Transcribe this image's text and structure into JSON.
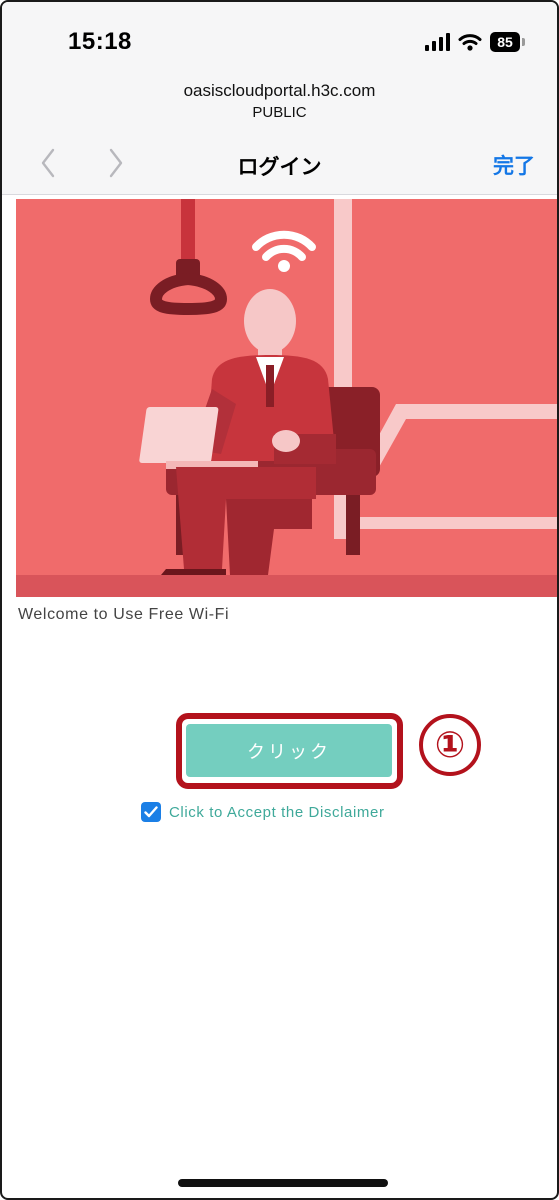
{
  "status_bar": {
    "time": "15:18",
    "battery": "85",
    "signal_icon": "signal-bars-icon",
    "wifi_icon": "wifi-icon"
  },
  "browser": {
    "domain": "oasiscloudportal.h3c.com",
    "ssid": "PUBLIC",
    "back_icon": "chevron-left-icon",
    "forward_icon": "chevron-right-icon",
    "title": "ログイン",
    "done_label": "完了"
  },
  "portal": {
    "welcome": "Welcome to Use Free Wi-Fi",
    "connect_label": "クリック",
    "disclaimer": "Click to Accept the Disclaimer",
    "disclaimer_checked": true,
    "step_marker": "①"
  },
  "colors": {
    "hero_bg": "#f06b6b",
    "button": "#74cebf",
    "highlight": "#b3121c",
    "link": "#1477e6",
    "checkbox": "#1b7fe6"
  }
}
